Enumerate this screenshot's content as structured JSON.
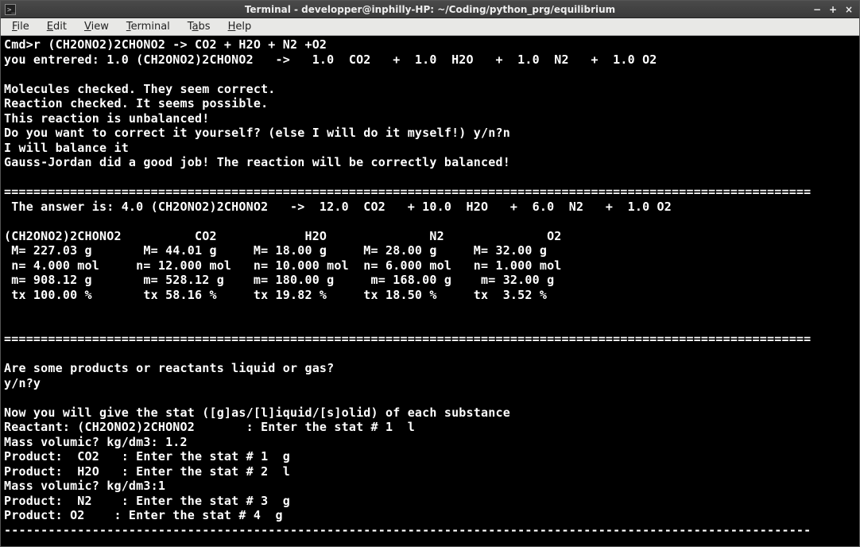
{
  "titlebar": {
    "title": "Terminal - developper@inphilly-HP: ~/Coding/python_prg/equilibrium"
  },
  "menubar": {
    "file": "File",
    "edit": "Edit",
    "view": "View",
    "terminal": "Terminal",
    "tabs": "Tabs",
    "help": "Help"
  },
  "lines": {
    "l01": "Cmd>r (CH2ONO2)2CHONO2 -> CO2 + H2O + N2 +O2",
    "l02": "you entrered: 1.0 (CH2ONO2)2CHONO2   ->   1.0  CO2   +  1.0  H2O   +  1.0  N2   +  1.0 O2",
    "l03": "",
    "l04": "Molecules checked. They seem correct.",
    "l05": "Reaction checked. It seems possible.",
    "l06": "This reaction is unbalanced!",
    "l07": "Do you want to correct it yourself? (else I will do it myself!) y/n?n",
    "l08": "I will balance it",
    "l09": "Gauss-Jordan did a good job! The reaction will be correctly balanced!",
    "l10": "",
    "l11": "==============================================================================================================",
    "l12": " The answer is: 4.0 (CH2ONO2)2CHONO2   ->  12.0  CO2   + 10.0  H2O   +  6.0  N2   +  1.0 O2",
    "l13": "",
    "l14": "(CH2ONO2)2CHONO2          CO2            H2O              N2              O2",
    "l15": " M= 227.03 g       M= 44.01 g     M= 18.00 g     M= 28.00 g     M= 32.00 g",
    "l16": " n= 4.000 mol     n= 12.000 mol   n= 10.000 mol  n= 6.000 mol   n= 1.000 mol",
    "l17": " m= 908.12 g       m= 528.12 g    m= 180.00 g     m= 168.00 g    m= 32.00 g",
    "l18": " tx 100.00 %       tx 58.16 %     tx 19.82 %     tx 18.50 %     tx  3.52 %",
    "l19": "",
    "l20": "",
    "l21": "==============================================================================================================",
    "l22": "",
    "l23": "Are some products or reactants liquid or gas?",
    "l24": "y/n?y",
    "l25": "",
    "l26": "Now you will give the stat ([g]as/[l]iquid/[s]olid) of each substance",
    "l27": "Reactant: (CH2ONO2)2CHONO2       : Enter the stat # 1  l",
    "l28": "Mass volumic? kg/dm3: 1.2",
    "l29": "Product:  CO2   : Enter the stat # 1  g",
    "l30": "Product:  H2O   : Enter the stat # 2  l",
    "l31": "Mass volumic? kg/dm3:1",
    "l32": "Product:  N2    : Enter the stat # 3  g",
    "l33": "Product: O2    : Enter the stat # 4  g",
    "l34": "--------------------------------------------------------------------------------------------------------------"
  }
}
